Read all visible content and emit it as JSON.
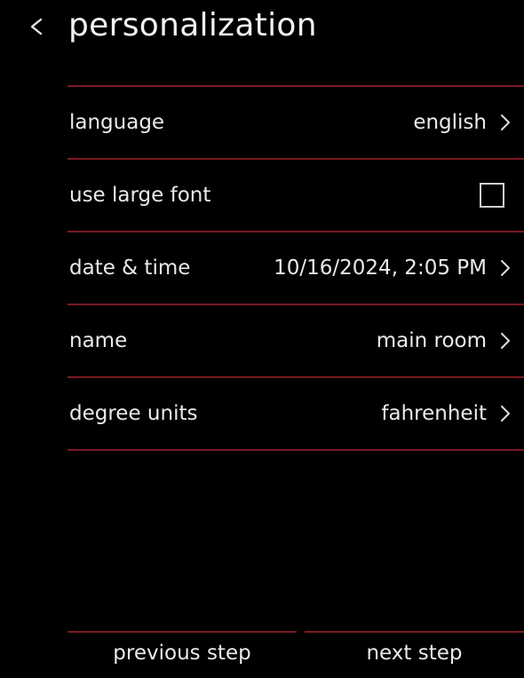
{
  "header": {
    "title": "personalization",
    "back_icon": "chevron-left-icon"
  },
  "colors": {
    "background": "#000000",
    "divider": "#7a1a1f",
    "text": "#eaeaea"
  },
  "settings": [
    {
      "label": "language",
      "value": "english",
      "control": "chevron"
    },
    {
      "label": "use large font",
      "value": "",
      "control": "checkbox",
      "checked": false
    },
    {
      "label": "date & time",
      "value": "10/16/2024, 2:05 PM",
      "control": "chevron"
    },
    {
      "label": "name",
      "value": "main room",
      "control": "chevron"
    },
    {
      "label": "degree units",
      "value": "fahrenheit",
      "control": "chevron"
    }
  ],
  "footer": {
    "previous_label": "previous step",
    "next_label": "next step"
  }
}
